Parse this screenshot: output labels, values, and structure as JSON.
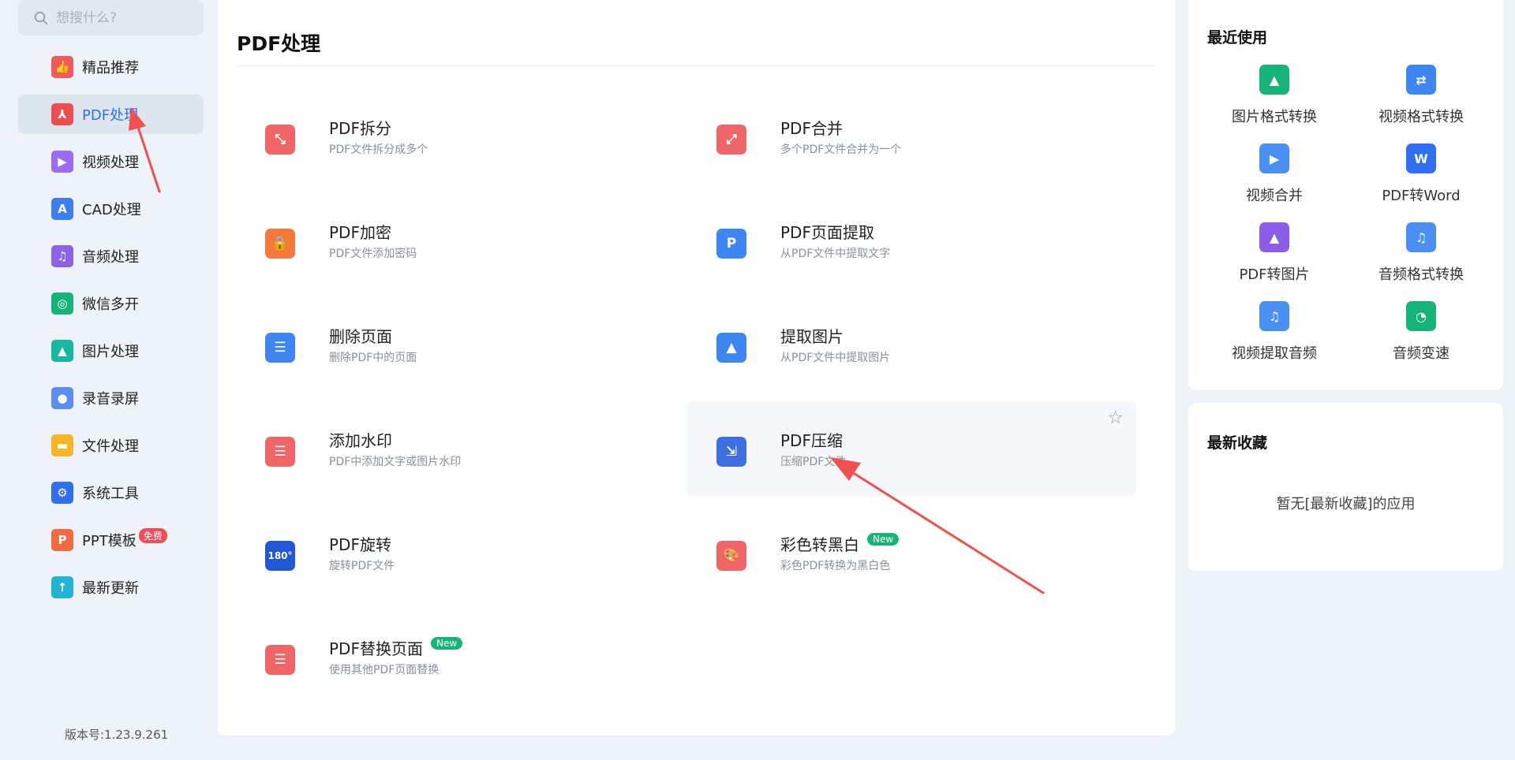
{
  "search": {
    "placeholder": "想搜什么?",
    "icon": "search-icon"
  },
  "sidebar": {
    "items": [
      {
        "label": "精品推荐",
        "icon": "thumbs-up-icon",
        "color": "#f05a5a",
        "glyph": "👍"
      },
      {
        "label": "PDF处理",
        "icon": "pdf-icon",
        "color": "#ef4e4e",
        "glyph": "⅄",
        "active": true
      },
      {
        "label": "视频处理",
        "icon": "play-icon",
        "color": "#9b6bf2",
        "glyph": "▶"
      },
      {
        "label": "CAD处理",
        "icon": "cad-icon",
        "color": "#3c7ef0",
        "glyph": "A"
      },
      {
        "label": "音频处理",
        "icon": "music-icon",
        "color": "#8c63e8",
        "glyph": "♫"
      },
      {
        "label": "微信多开",
        "icon": "wechat-icon",
        "color": "#17b47a",
        "glyph": "◎"
      },
      {
        "label": "图片处理",
        "icon": "image-icon",
        "color": "#17b8a0",
        "glyph": "▲"
      },
      {
        "label": "录音录屏",
        "icon": "microphone-icon",
        "color": "#5b8cf3",
        "glyph": "●"
      },
      {
        "label": "文件处理",
        "icon": "folder-icon",
        "color": "#f6b524",
        "glyph": "▬"
      },
      {
        "label": "系统工具",
        "icon": "gear-icon",
        "color": "#2f6ff0",
        "glyph": "⚙"
      },
      {
        "label": "PPT模板",
        "icon": "ppt-icon",
        "color": "#f26a3d",
        "glyph": "P",
        "badge": "免费"
      },
      {
        "label": "最新更新",
        "icon": "upload-icon",
        "color": "#22b4d6",
        "glyph": "↑"
      }
    ],
    "version": "版本号:1.23.9.261"
  },
  "main": {
    "title": "PDF处理",
    "tools": [
      {
        "name": "PDF拆分",
        "desc": "PDF文件拆分成多个",
        "icon": "pdf-split-icon",
        "color": "#f06565",
        "glyph": "⤡"
      },
      {
        "name": "PDF合并",
        "desc": "多个PDF文件合并为一个",
        "icon": "pdf-merge-icon",
        "color": "#f06565",
        "glyph": "⤢"
      },
      {
        "name": "PDF加密",
        "desc": "PDF文件添加密码",
        "icon": "lock-icon",
        "color": "#f5793a",
        "glyph": "🔒"
      },
      {
        "name": "PDF页面提取",
        "desc": "从PDF文件中提取文字",
        "icon": "page-extract-icon",
        "color": "#3e87f2",
        "glyph": "P"
      },
      {
        "name": "删除页面",
        "desc": "删除PDF中的页面",
        "icon": "delete-page-icon",
        "color": "#3e87f2",
        "glyph": "☰"
      },
      {
        "name": "提取图片",
        "desc": "从PDF文件中提取图片",
        "icon": "extract-image-icon",
        "color": "#3e87f2",
        "glyph": "▲"
      },
      {
        "name": "添加水印",
        "desc": "PDF中添加文字或图片水印",
        "icon": "watermark-icon",
        "color": "#f06565",
        "glyph": "☰"
      },
      {
        "name": "PDF压缩",
        "desc": "压缩PDF文件",
        "icon": "compress-icon",
        "color": "#3e6fe0",
        "glyph": "⇲",
        "hover": true
      },
      {
        "name": "PDF旋转",
        "desc": "旋转PDF文件",
        "icon": "rotate-icon",
        "color": "#2257d6",
        "glyph": "180°"
      },
      {
        "name": "彩色转黑白",
        "desc": "彩色PDF转换为黑白色",
        "icon": "palette-icon",
        "color": "#f06565",
        "glyph": "🎨",
        "badge": "New"
      },
      {
        "name": "PDF替换页面",
        "desc": "使用其他PDF页面替换",
        "icon": "replace-page-icon",
        "color": "#f06565",
        "glyph": "☰",
        "badge": "New"
      }
    ],
    "star_icon": "star-icon"
  },
  "recent": {
    "title": "最近使用",
    "items": [
      {
        "label": "图片格式转换",
        "icon": "image-convert-icon",
        "color": "#17b47a",
        "glyph": "▲"
      },
      {
        "label": "视频格式转换",
        "icon": "swap-icon",
        "color": "#3e87f2",
        "glyph": "⇄"
      },
      {
        "label": "视频合并",
        "icon": "video-merge-icon",
        "color": "#4a8ff2",
        "glyph": "▶"
      },
      {
        "label": "PDF转Word",
        "icon": "pdf-to-word-icon",
        "color": "#2f6ff0",
        "glyph": "W"
      },
      {
        "label": "PDF转图片",
        "icon": "pdf-to-image-icon",
        "color": "#8c5ee8",
        "glyph": "▲"
      },
      {
        "label": "音频格式转换",
        "icon": "audio-convert-icon",
        "color": "#4a8ff2",
        "glyph": "♫"
      },
      {
        "label": "视频提取音频",
        "icon": "extract-audio-icon",
        "color": "#4a8ff2",
        "glyph": "♫"
      },
      {
        "label": "音频变速",
        "icon": "speed-icon",
        "color": "#17b47a",
        "glyph": "◔"
      }
    ]
  },
  "favorites": {
    "title": "最新收藏",
    "empty_text": "暂无[最新收藏]的应用"
  }
}
